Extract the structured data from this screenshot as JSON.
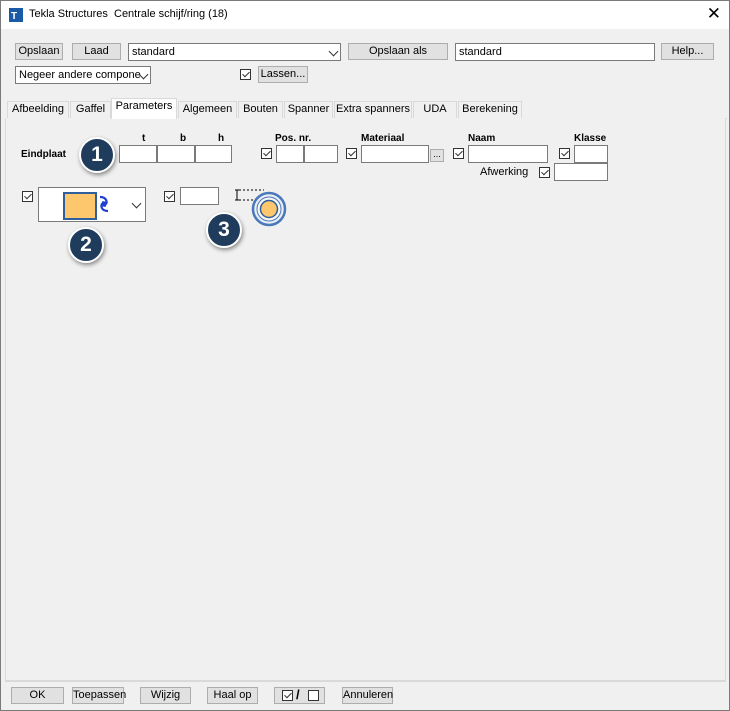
{
  "window": {
    "app_name": "Tekla Structures",
    "dialog_title": "Centrale schijf/ring (18)",
    "close_symbol": "✕"
  },
  "toolbar": {
    "save_label": "Opslaan",
    "load_label": "Laad",
    "preset_value": "standard",
    "save_as_label": "Opslaan als",
    "save_as_value": "standard",
    "help_label": "Help...",
    "ignore_value": "Negeer andere compone",
    "welds_label": "Lassen..."
  },
  "tabs": [
    {
      "label": "Afbeelding"
    },
    {
      "label": "Gaffel"
    },
    {
      "label": "Parameters"
    },
    {
      "label": "Algemeen"
    },
    {
      "label": "Bouten"
    },
    {
      "label": "Spanner"
    },
    {
      "label": "Extra spanners"
    },
    {
      "label": "UDA"
    },
    {
      "label": "Berekening"
    }
  ],
  "active_tab": "Parameters",
  "parameters": {
    "row_label": "Eindplaat",
    "col_t": "t",
    "col_b": "b",
    "col_h": "h",
    "pos_nr_label": "Pos. nr.",
    "material_label": "Materiaal",
    "browse_label": "...",
    "name_label": "Naam",
    "class_label": "Klasse",
    "finish_label": "Afwerking",
    "fields": {
      "t": "",
      "b": "",
      "h": "",
      "pos_prefix": "",
      "pos_start": "",
      "material": "",
      "name": "",
      "class": "",
      "finish": "",
      "small": ""
    }
  },
  "callouts": [
    "1",
    "2",
    "3"
  ],
  "footer": {
    "ok_label": "OK",
    "apply_label": "Toepassen",
    "modify_label": "Wijzig",
    "get_label": "Haal op",
    "toggle_separator": "/",
    "cancel_label": "Annuleren"
  },
  "colors": {
    "callout_fill": "#1f3c5c",
    "shape_swatch": "#fdc86d",
    "swap_icon": "#1e3fd1",
    "ring_outline": "#4a78b8"
  },
  "icons": [
    "tekla-app-icon",
    "close-icon",
    "chevron-down-icon",
    "checkbox-checked-icon",
    "swap-arrows-icon",
    "dimension-icon",
    "ring-icon"
  ]
}
